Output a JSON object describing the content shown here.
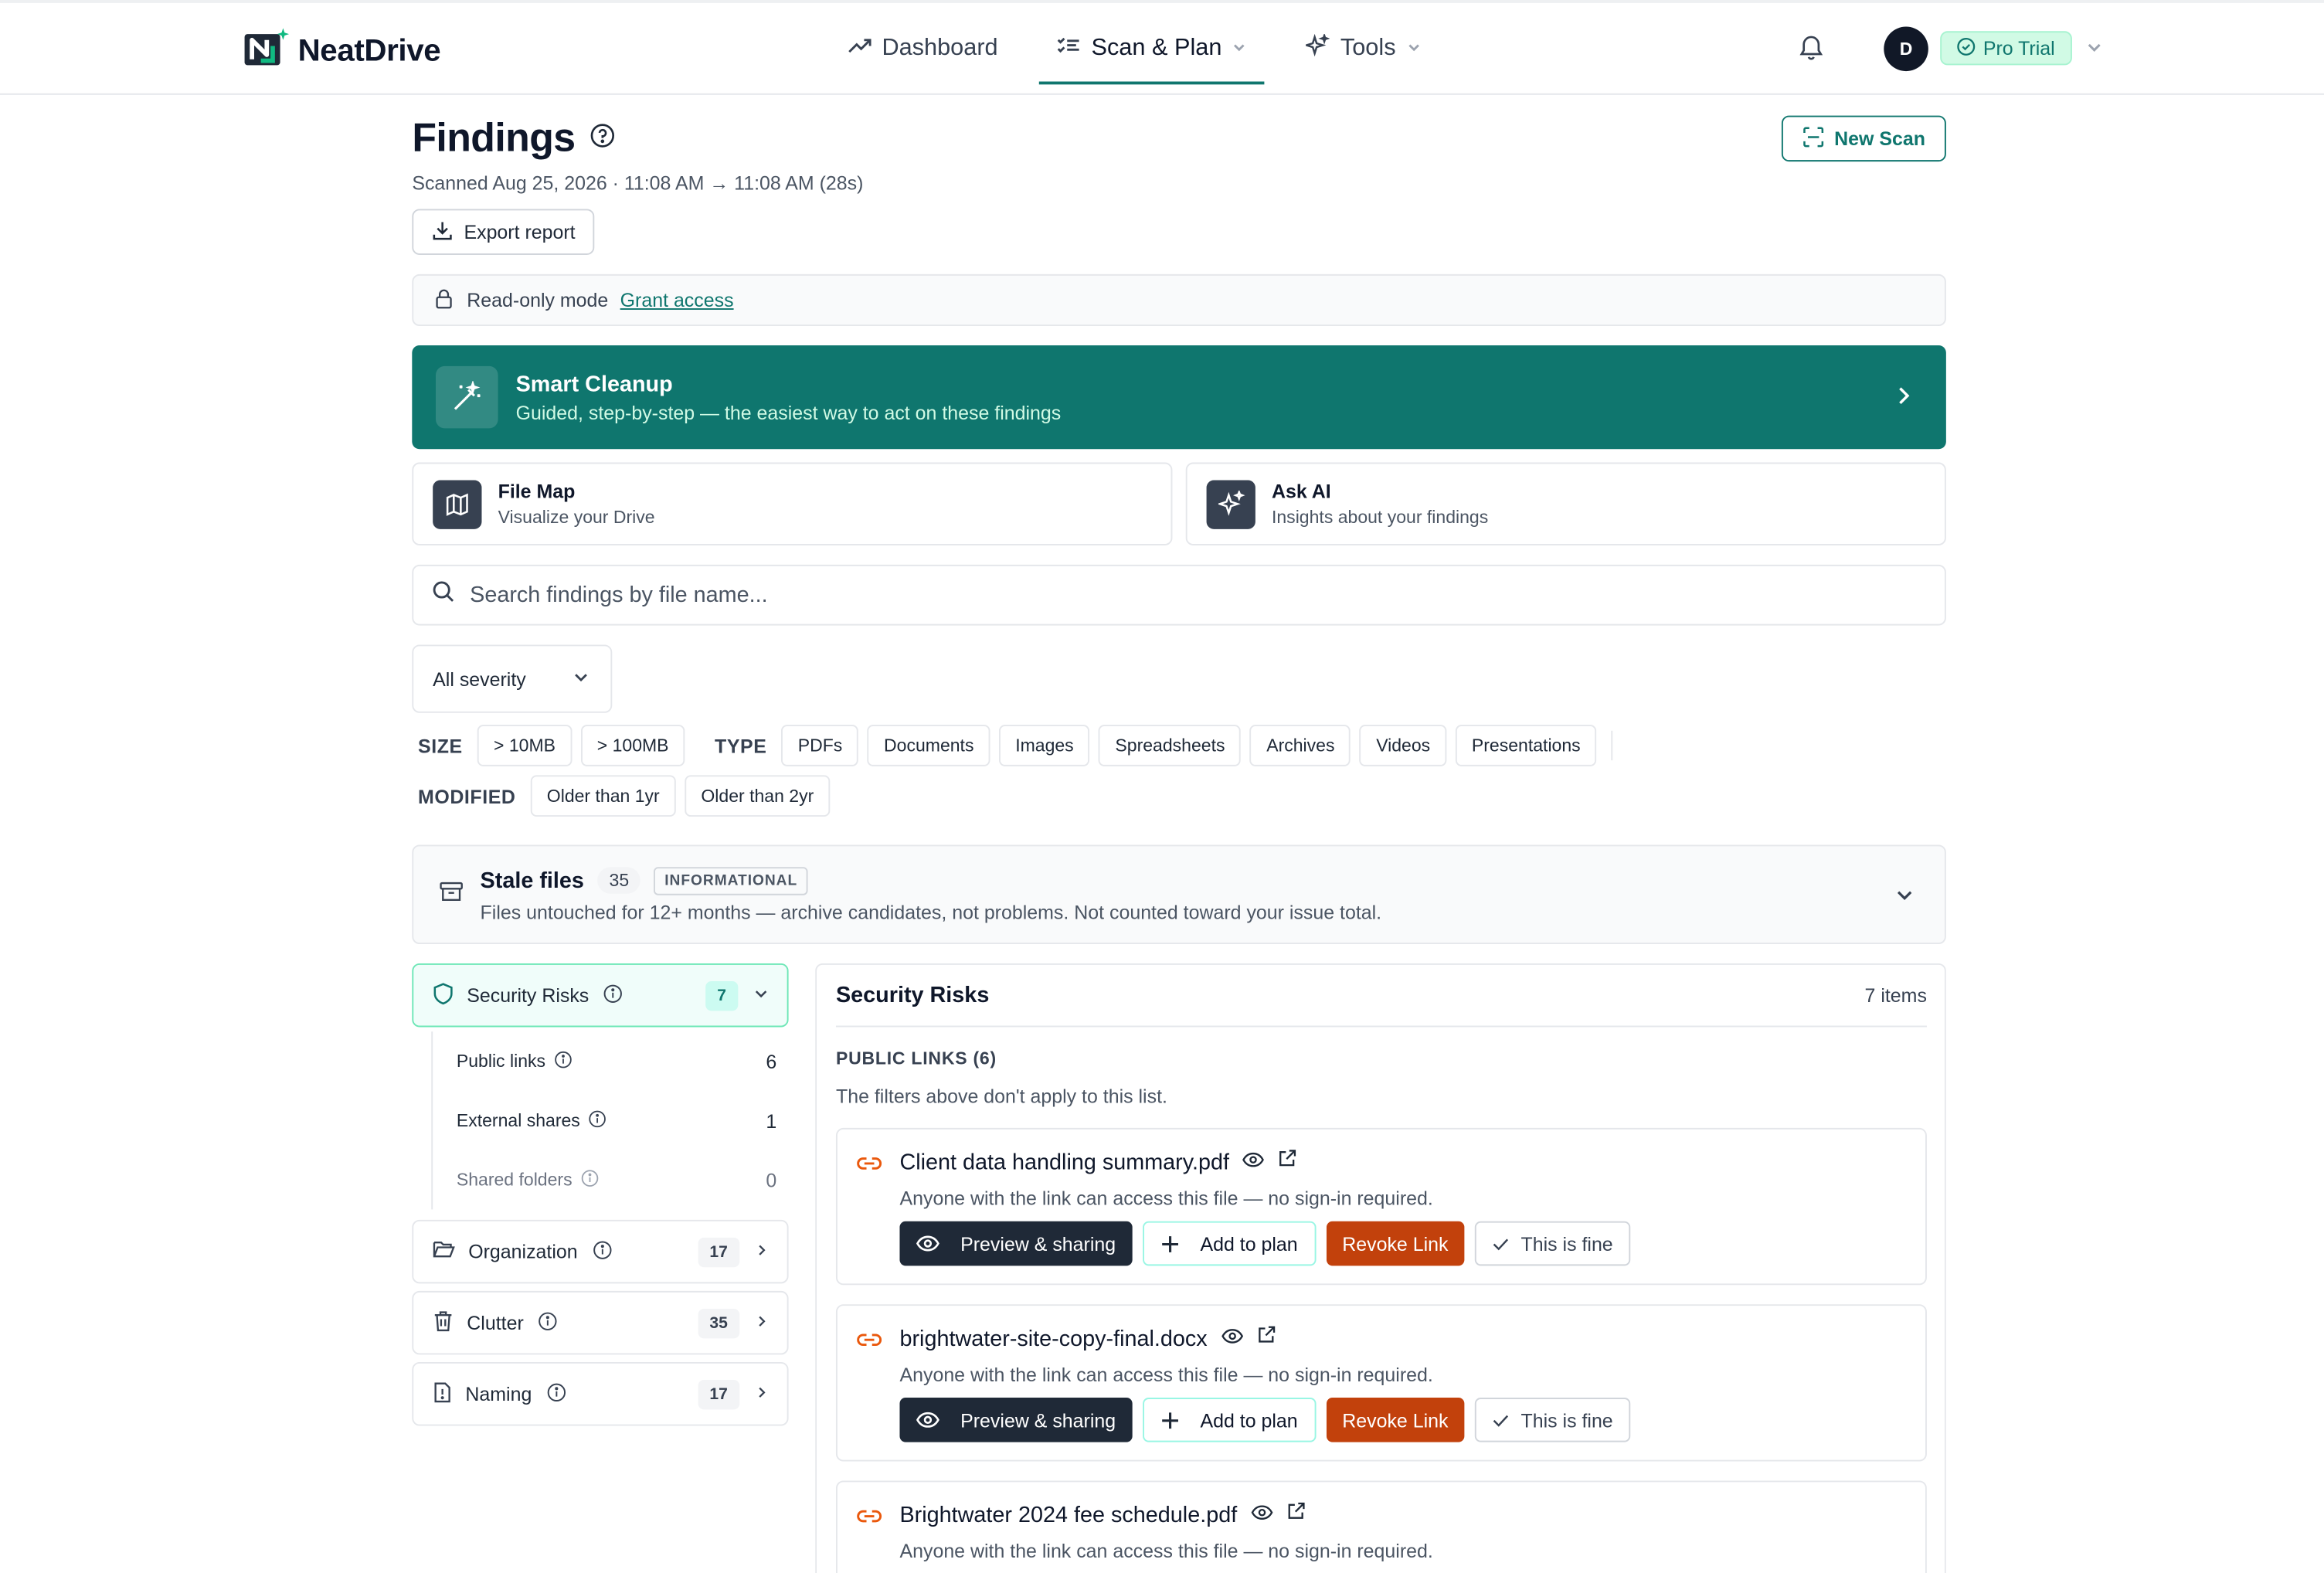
{
  "app": {
    "brand": "NeatDrive",
    "accent": "#0f766e"
  },
  "nav": {
    "dashboard": "Dashboard",
    "scan_plan": "Scan & Plan",
    "tools": "Tools"
  },
  "user": {
    "avatar_initial": "D",
    "plan_badge": "Pro Trial"
  },
  "header": {
    "title": "Findings",
    "scanned": "Scanned Aug 25, 2026 · 11:08 AM → 11:08 AM (28s)",
    "export_label": "Export report",
    "new_scan_label": "New Scan"
  },
  "readonly": {
    "text": "Read-only mode",
    "link": "Grant access"
  },
  "smart_cleanup": {
    "title": "Smart Cleanup",
    "subtitle": "Guided, step-by-step — the easiest way to act on these findings"
  },
  "cards": [
    {
      "title": "File Map",
      "subtitle": "Visualize your Drive"
    },
    {
      "title": "Ask AI",
      "subtitle": "Insights about your findings"
    }
  ],
  "search": {
    "placeholder": "Search findings by file name..."
  },
  "filters": {
    "severity": "All severity",
    "size_label": "SIZE",
    "size": [
      "> 10MB",
      "> 100MB"
    ],
    "type_label": "TYPE",
    "type": [
      "PDFs",
      "Documents",
      "Images",
      "Spreadsheets",
      "Archives",
      "Videos",
      "Presentations"
    ],
    "modified_label": "MODIFIED",
    "modified": [
      "Older than 1yr",
      "Older than 2yr"
    ]
  },
  "stale": {
    "title": "Stale files",
    "count": "35",
    "badge": "INFORMATIONAL",
    "subtitle": "Files untouched for 12+ months — archive candidates, not problems. Not counted toward your issue total."
  },
  "sidebar": {
    "security": {
      "label": "Security Risks",
      "count": "7"
    },
    "sub": [
      {
        "label": "Public links",
        "count": "6"
      },
      {
        "label": "External shares",
        "count": "1"
      },
      {
        "label": "Shared folders",
        "count": "0"
      }
    ],
    "categories": [
      {
        "label": "Organization",
        "count": "17"
      },
      {
        "label": "Clutter",
        "count": "35"
      },
      {
        "label": "Naming",
        "count": "17"
      }
    ]
  },
  "panel": {
    "title": "Security Risks",
    "count": "7 items",
    "section_label": "PUBLIC LINKS (6)",
    "section_note": "The filters above don't apply to this list.",
    "actions": {
      "preview": "Preview & sharing",
      "add": "Add to plan",
      "revoke": "Revoke Link",
      "fine": "This is fine"
    },
    "findings": [
      {
        "name": "Client data handling summary.pdf",
        "desc": "Anyone with the link can access this file — no sign-in required."
      },
      {
        "name": "brightwater-site-copy-final.docx",
        "desc": "Anyone with the link can access this file — no sign-in required."
      },
      {
        "name": "Brightwater 2024 fee schedule.pdf",
        "desc": "Anyone with the link can access this file — no sign-in required."
      }
    ]
  }
}
